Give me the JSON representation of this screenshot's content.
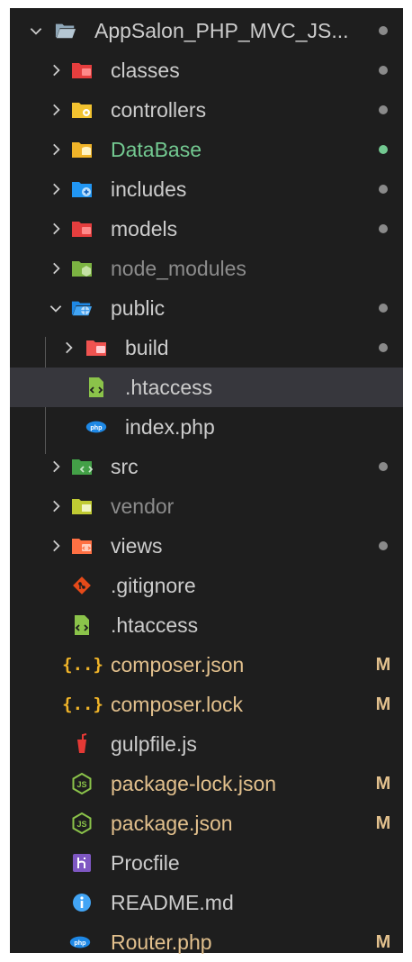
{
  "explorer": {
    "root": {
      "label": "AppSalon_PHP_MVC_JS...",
      "status": "dot",
      "color": "#cccccc",
      "dot_color": "#8a8a8a",
      "icon": "folder-open-icon"
    },
    "items": [
      {
        "label": "classes",
        "kind": "folder",
        "color": "#cccccc",
        "status": "dot",
        "dot_color": "#8a8a8a",
        "icon": "folder-classes-icon"
      },
      {
        "label": "controllers",
        "kind": "folder",
        "color": "#cccccc",
        "status": "dot",
        "dot_color": "#8a8a8a",
        "icon": "folder-controllers-icon"
      },
      {
        "label": "DataBase",
        "kind": "folder",
        "color": "#73c991",
        "status": "dot",
        "dot_color": "#73c991",
        "icon": "folder-database-icon"
      },
      {
        "label": "includes",
        "kind": "folder",
        "color": "#cccccc",
        "status": "dot",
        "dot_color": "#8a8a8a",
        "icon": "folder-include-icon"
      },
      {
        "label": "models",
        "kind": "folder",
        "color": "#cccccc",
        "status": "dot",
        "dot_color": "#8a8a8a",
        "icon": "folder-models-icon"
      },
      {
        "label": "node_modules",
        "kind": "folder",
        "color": "#8c8c8c",
        "status": "",
        "icon": "folder-node-icon"
      },
      {
        "label": "public",
        "kind": "folder-open",
        "color": "#cccccc",
        "status": "dot",
        "dot_color": "#8a8a8a",
        "icon": "folder-public-icon"
      },
      {
        "label": "build",
        "kind": "folder",
        "color": "#cccccc",
        "status": "dot",
        "dot_color": "#8a8a8a",
        "icon": "folder-build-icon"
      },
      {
        "label": ".htaccess",
        "kind": "file",
        "color": "#cccccc",
        "status": "",
        "icon": "htaccess-icon"
      },
      {
        "label": "index.php",
        "kind": "file",
        "color": "#cccccc",
        "status": "",
        "icon": "php-icon"
      },
      {
        "label": "src",
        "kind": "folder",
        "color": "#cccccc",
        "status": "dot",
        "dot_color": "#8a8a8a",
        "icon": "folder-src-icon"
      },
      {
        "label": "vendor",
        "kind": "folder",
        "color": "#8c8c8c",
        "status": "",
        "icon": "folder-vendor-icon"
      },
      {
        "label": "views",
        "kind": "folder",
        "color": "#cccccc",
        "status": "dot",
        "dot_color": "#8a8a8a",
        "icon": "folder-views-icon"
      },
      {
        "label": ".gitignore",
        "kind": "file",
        "color": "#cccccc",
        "status": "",
        "icon": "git-icon"
      },
      {
        "label": ".htaccess",
        "kind": "file",
        "color": "#cccccc",
        "status": "",
        "icon": "htaccess-icon"
      },
      {
        "label": "composer.json",
        "kind": "file",
        "color": "#e2c08d",
        "status": "M",
        "icon": "json-icon"
      },
      {
        "label": "composer.lock",
        "kind": "file",
        "color": "#e2c08d",
        "status": "M",
        "icon": "json-icon"
      },
      {
        "label": "gulpfile.js",
        "kind": "file",
        "color": "#cccccc",
        "status": "",
        "icon": "gulp-icon"
      },
      {
        "label": "package-lock.json",
        "kind": "file",
        "color": "#e2c08d",
        "status": "M",
        "icon": "nodejs-icon"
      },
      {
        "label": "package.json",
        "kind": "file",
        "color": "#e2c08d",
        "status": "M",
        "icon": "nodejs-icon"
      },
      {
        "label": "Procfile",
        "kind": "file",
        "color": "#cccccc",
        "status": "",
        "icon": "heroku-icon"
      },
      {
        "label": "README.md",
        "kind": "file",
        "color": "#cccccc",
        "status": "",
        "icon": "info-icon"
      },
      {
        "label": "Router.php",
        "kind": "file",
        "color": "#e2c08d",
        "status": "M",
        "icon": "php-icon"
      }
    ]
  },
  "colors": {
    "background": "#1e1e1e",
    "selected_row": "#37373d",
    "modified": "#e2c08d",
    "untracked": "#73c991",
    "ignored": "#8c8c8c"
  }
}
